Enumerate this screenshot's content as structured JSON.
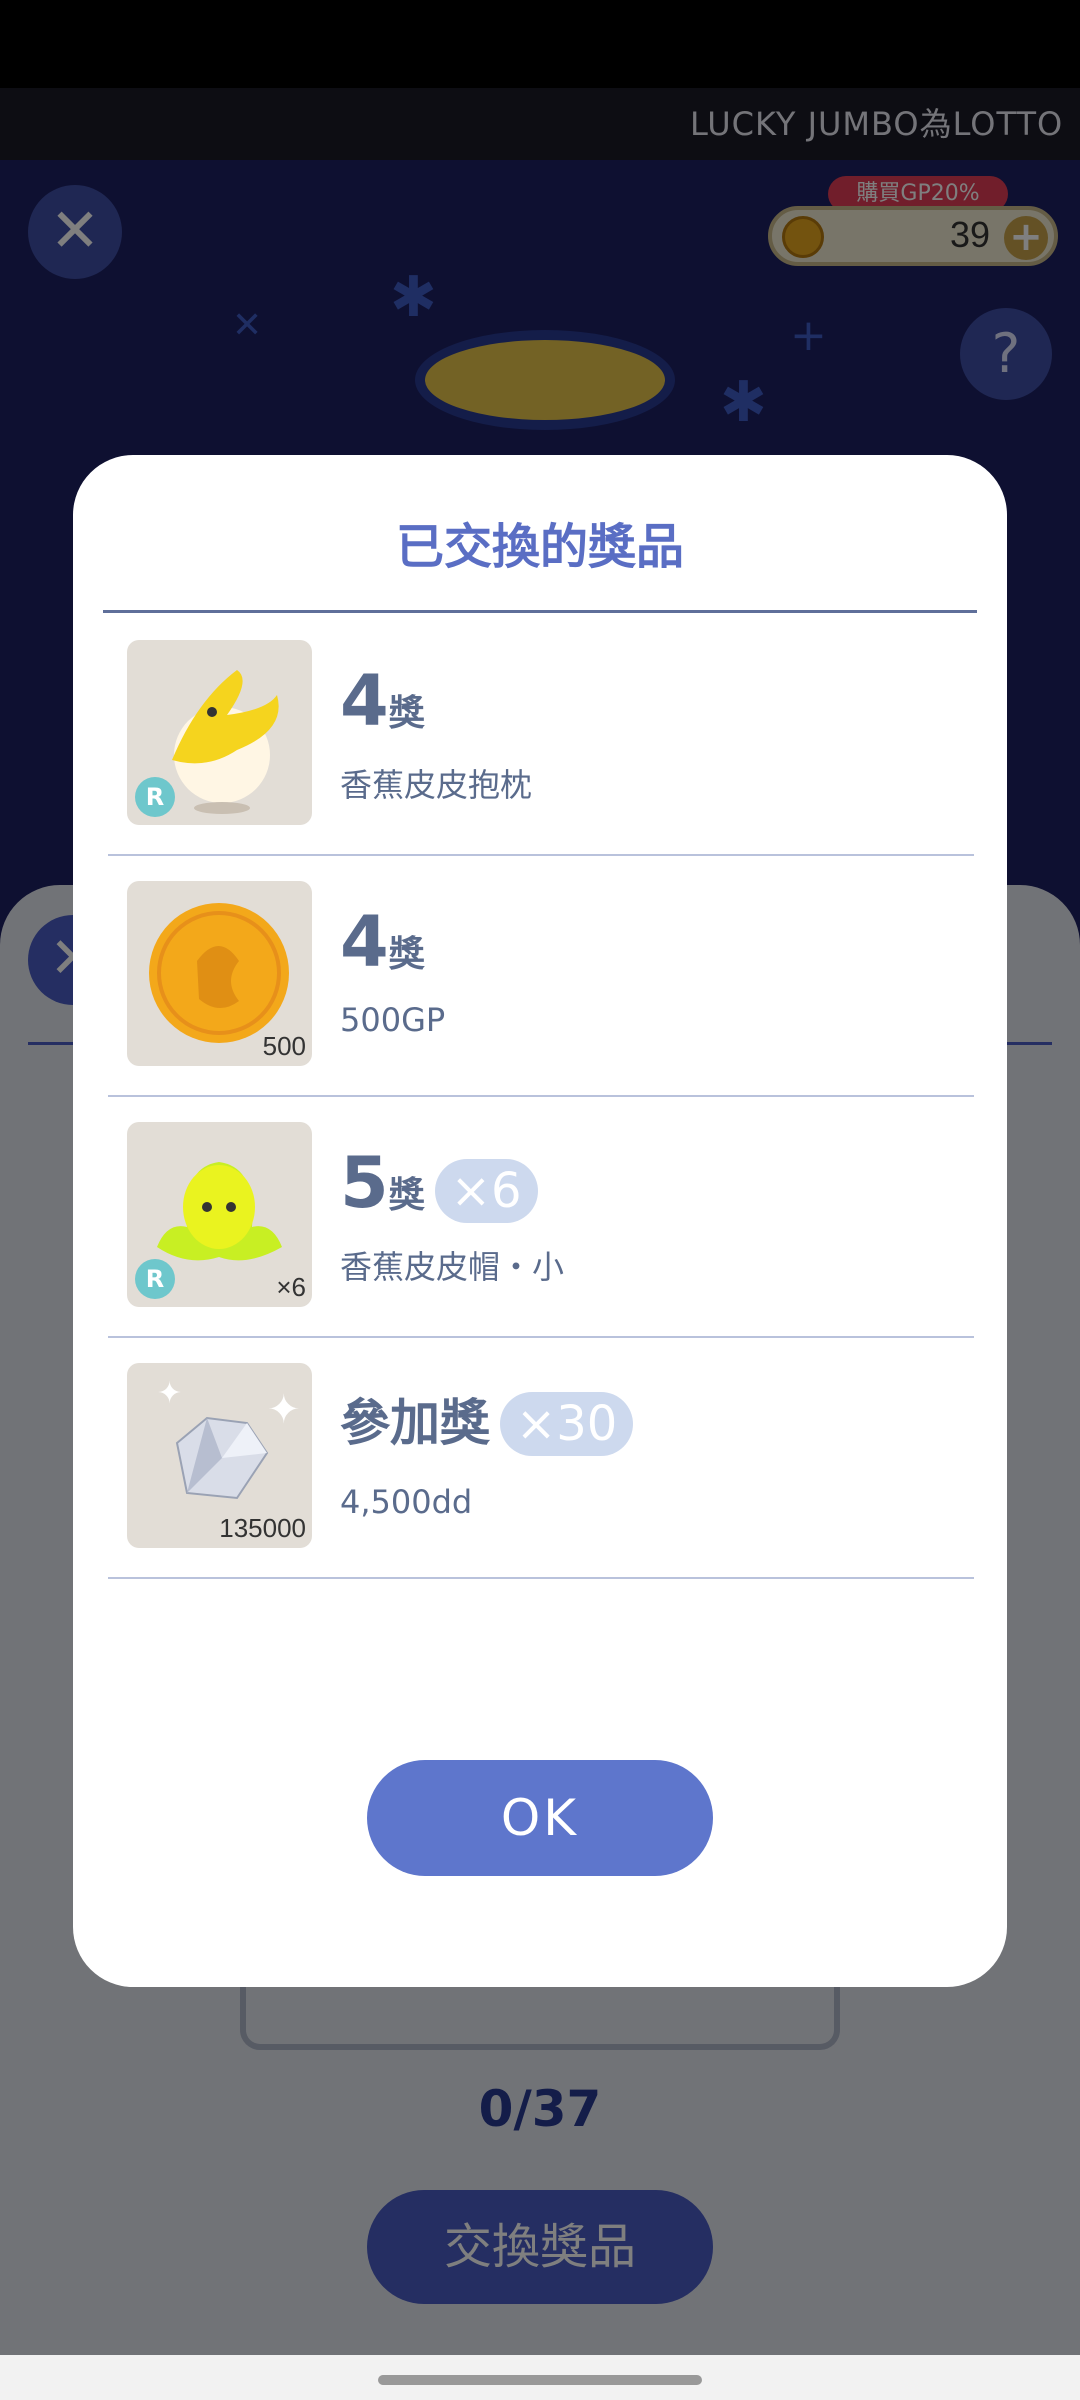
{
  "ticker": {
    "text": "LUCKY JUMBO為LOTTO"
  },
  "header": {
    "close_icon": "close-icon",
    "gp_badge": "購買GP20%",
    "gp_value": "39",
    "plus_icon": "plus-icon",
    "help_label": "?"
  },
  "background": {
    "progress": "0/37",
    "exchange_button": "交換獎品"
  },
  "modal": {
    "title": "已交換的獎品",
    "prizes": [
      {
        "rank_num": "4",
        "rank_word": "獎",
        "rank_text": "",
        "multiplier": "",
        "name": "香蕉皮皮抱枕",
        "rarity": "R",
        "qty_label": "",
        "icon": "banana-pillow-icon"
      },
      {
        "rank_num": "4",
        "rank_word": "獎",
        "rank_text": "",
        "multiplier": "",
        "name": "500GP",
        "rarity": "",
        "qty_label": "500",
        "icon": "gold-coin-icon"
      },
      {
        "rank_num": "5",
        "rank_word": "獎",
        "rank_text": "",
        "multiplier": "×6",
        "name": "香蕉皮皮帽・小",
        "rarity": "R",
        "qty_label": "×6",
        "icon": "yellow-blob-icon"
      },
      {
        "rank_num": "",
        "rank_word": "",
        "rank_text": "參加獎",
        "multiplier": "×30",
        "name": "4,500dd",
        "rarity": "",
        "qty_label": "135000",
        "icon": "diamond-icon"
      }
    ],
    "ok_label": "OK"
  },
  "colors": {
    "accent": "#5e76cc",
    "title": "#5a6ec4",
    "text": "#5a6b8c",
    "chip": "#cdd9ee"
  }
}
